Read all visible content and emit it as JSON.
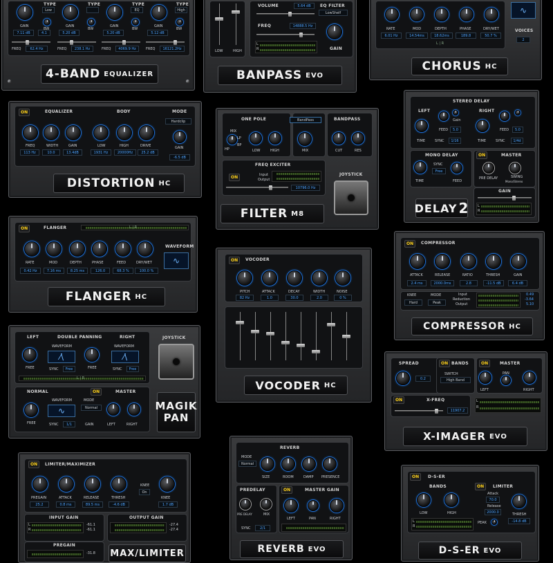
{
  "colors": {
    "accent": "#2a8cff",
    "on": "#ffd21a",
    "meter": "#3b5a24"
  },
  "eq4": {
    "logo": "4-BAND",
    "logo_small": "EQUALIZER",
    "type_label": "TYPE",
    "gain_label": "GAIN",
    "bw_label": "BW",
    "freq_label": "FREQ",
    "bands": [
      {
        "type": "Low",
        "gain": "7.11 dB",
        "bw": "4.1",
        "freq": "62.4 Hz"
      },
      {
        "type": "",
        "gain": "5.20 dB",
        "bw": "",
        "freq": "238.1 Hz"
      },
      {
        "type": "EQ",
        "gain": "5.20 dB",
        "bw": "",
        "freq": "4069.9 Hz"
      },
      {
        "type": "High",
        "gain": "5.12 dB",
        "bw": "",
        "freq": "16121.2Hz"
      }
    ]
  },
  "banpass": {
    "logo": "BANPASS",
    "logo_small": "EVO",
    "volume_label": "VOLUME",
    "volume": "5.64 dB",
    "eq_filter_label": "EQ FILTER",
    "eq_filter": "LowShelf",
    "freq_label": "FREQ",
    "freq": "14888.5 Hz",
    "gain_label": "GAIN",
    "low": "LOW",
    "high": "HIGH",
    "l": "L",
    "r": "R"
  },
  "chorus": {
    "logo": "CHORUS",
    "logo_small": "HC",
    "knobs": [
      {
        "label": "RATE",
        "value": "6.01 Hz"
      },
      {
        "label": "MOD",
        "value": "14.54ms"
      },
      {
        "label": "DEPTH",
        "value": "18.62ms"
      },
      {
        "label": "PHASE",
        "value": "189.8"
      },
      {
        "label": "DRY/WET",
        "value": "50.7 %"
      }
    ],
    "voices_label": "VOICES",
    "voices": "2",
    "lr": "L | R"
  },
  "distortion": {
    "logo": "DISTORTION",
    "logo_small": "HC",
    "on": "ON",
    "eq_label": "EQUALIZER",
    "body_label": "BODY",
    "mode_label": "MODE",
    "mode": "Hardclip",
    "gain_label": "GAIN",
    "gain": "-6.5 dB",
    "knobs": [
      {
        "label": "FREQ",
        "value": "113 Hz"
      },
      {
        "label": "WIDTH",
        "value": "10.0"
      },
      {
        "label": "GAIN",
        "value": "13.4dB"
      },
      {
        "label": "LOW",
        "value": "1931 Hz"
      },
      {
        "label": "HIGH",
        "value": "20000Hz"
      },
      {
        "label": "DRIVE",
        "value": "25.2 dB"
      }
    ]
  },
  "filter": {
    "logo": "FILTER",
    "logo_small": "M8",
    "one_pole": "ONE POLE",
    "type": "BandPass",
    "bandpass": "BANDPASS",
    "mix": "MIX",
    "hp": "HP",
    "bp": "BP",
    "lp": "LP",
    "low": "LOW",
    "high": "HIGH",
    "mix2": "MIX",
    "cut": "CUT",
    "res": "RES",
    "freq_exciter": "FREQ EXCITER",
    "input": "Input",
    "output": "Output",
    "on": "ON",
    "freq": "10796.0 Hz",
    "joystick": "JOYSTICK"
  },
  "delay2": {
    "logo": "DELAY",
    "logo_num": "2",
    "stereo": "STEREO DELAY",
    "left": "LEFT",
    "right": "RIGHT",
    "feed": "FEED",
    "gain": "Gain",
    "feed_val": "5.0",
    "time": "TIME",
    "sync": "SYNC",
    "sync_l": "1/16",
    "sync_r": "1/4d",
    "mono": "MONO DELAY",
    "on": "ON",
    "master": "MASTER",
    "msync": "SYNC",
    "mfree": "Free",
    "pre_delay": "PRE DELAY",
    "swing": "SWING",
    "mono_stereo": "Mono/Stereo",
    "gain2": "GAIN",
    "l": "L",
    "r": "R"
  },
  "flanger": {
    "logo": "FLANGER",
    "logo_small": "HC",
    "on": "ON",
    "title": "FLANGER",
    "lr": "L | R",
    "waveform": "WAVEFORM",
    "knobs": [
      {
        "label": "RATE",
        "value": "0.42 Hz"
      },
      {
        "label": "MOD",
        "value": "7.16 ms"
      },
      {
        "label": "DEPTH",
        "value": "8.25 ms"
      },
      {
        "label": "PHASE",
        "value": "126.0"
      },
      {
        "label": "FEED",
        "value": "68.3 %"
      },
      {
        "label": "DRY/WET",
        "value": "100.0 %"
      }
    ]
  },
  "vocoder": {
    "logo": "VOCODER",
    "logo_small": "HC",
    "on": "ON",
    "title": "VOCODER",
    "knobs": [
      {
        "label": "PITCH",
        "value": "82 Hz"
      },
      {
        "label": "ATTACK",
        "value": "1.0"
      },
      {
        "label": "DECAY",
        "value": "30.0"
      },
      {
        "label": "WIDTH",
        "value": "2.0"
      },
      {
        "label": "NOISE",
        "value": "0 %"
      }
    ],
    "fader_levels": [
      0.8,
      0.6,
      0.55,
      0.35,
      0.3,
      0.15,
      0.75,
      0.5
    ]
  },
  "compressor": {
    "logo": "COMPRESSOR",
    "logo_small": "HC",
    "on": "ON",
    "title": "COMPRESSOR",
    "knobs": [
      {
        "label": "ATTACK",
        "value": "2.4 ms"
      },
      {
        "label": "RELEASE",
        "value": "2000.0ms"
      },
      {
        "label": "RATIO",
        "value": "2.8"
      },
      {
        "label": "THRESH",
        "value": "-11.5 dB"
      },
      {
        "label": "GAIN",
        "value": "6.4 dB"
      }
    ],
    "knee": "KNEE",
    "knee_val": "Hard",
    "mode": "MODE",
    "mode_val": "Peak",
    "input": "Input",
    "reduction": "Reduction",
    "output": "Output",
    "in_val": "0.49",
    "red_val": "-3.64",
    "out_val": "5.10"
  },
  "magikpan": {
    "logo1": "MAGIK",
    "logo2": "PAN",
    "left": "LEFT",
    "double": "DOUBLE PANNING",
    "right": "RIGHT",
    "waveform": "WAVEFORM",
    "free": "FREE",
    "sync": "SYNC",
    "free_val": "Free",
    "lr": "L | R",
    "normal": "NORMAL",
    "on": "ON",
    "master": "MASTER",
    "mode": "MODE",
    "mode_val": "Normal",
    "sync_val": "1/1",
    "gain": "GAIN",
    "mleft": "LEFT",
    "mright": "RIGHT",
    "joystick": "JOYSTICK"
  },
  "ximager": {
    "logo": "X-IMAGER",
    "logo_small": "EVO",
    "spread": "SPREAD",
    "on": "ON",
    "bands": "BANDS",
    "master": "MASTER",
    "spread_val": "0.2",
    "switch": "SWITCH",
    "switch_val": "High Band",
    "pan": "PAN",
    "left": "LEFT",
    "right": "RIGHT",
    "xfreq": "X-FREQ",
    "xfreq_val": "11907.2",
    "l": "L",
    "r": "R"
  },
  "limiter": {
    "logo": "MAX/LIMITER",
    "on": "ON",
    "title": "LIMITER/MAXIMIZER",
    "knobs": [
      {
        "label": "PREGAIN",
        "value": "25.2"
      },
      {
        "label": "ATTACK",
        "value": "0.8 ms"
      },
      {
        "label": "RELEASE",
        "value": "89.5 ms"
      },
      {
        "label": "THRESH",
        "value": "-4.6 dB"
      }
    ],
    "knee": "KNEE",
    "knee_on": "On",
    "knee_label": "KNEE",
    "knee_val": "1.7 dB",
    "input_gain": "INPUT GAIN",
    "output_gain": "OUTPUT GAIN",
    "in_l": "-61.1",
    "in_r": "-61.1",
    "out_l": "-27.4",
    "out_r": "-27.4",
    "pregain": "PREGAIN",
    "pregain_val": "-31.8",
    "l": "L",
    "r": "R"
  },
  "reverb": {
    "logo": "REVERB",
    "logo_small": "EVO",
    "title": "REVERB",
    "mode": "MODE",
    "mode_val": "Normal",
    "knobs": [
      "SIZE",
      "ROOM",
      "DAMP",
      "PRESENCE"
    ],
    "predelay": "PREDELAY",
    "on": "ON",
    "master_gain": "MASTER GAIN",
    "pre_delay": "PRE DELAY",
    "mix": "MIX",
    "left": "LEFT",
    "pan": "PAN",
    "right": "RIGHT",
    "sync": "SYNC",
    "sync_val": "2/1"
  },
  "dser": {
    "logo": "D-S-ER",
    "logo_small": "EVO",
    "on": "ON",
    "title": "D-S-ER",
    "bands": "BANDS",
    "limiter": "LIMITER",
    "low": "LOW",
    "high": "HIGH",
    "attack": "Attack",
    "attack_val": "70.0",
    "release": "Release",
    "release_val": "2000.0",
    "peak": "PEAK",
    "thresh": "THRESH",
    "thresh_val": "-14.8 dB",
    "l": "L",
    "r": "R"
  }
}
